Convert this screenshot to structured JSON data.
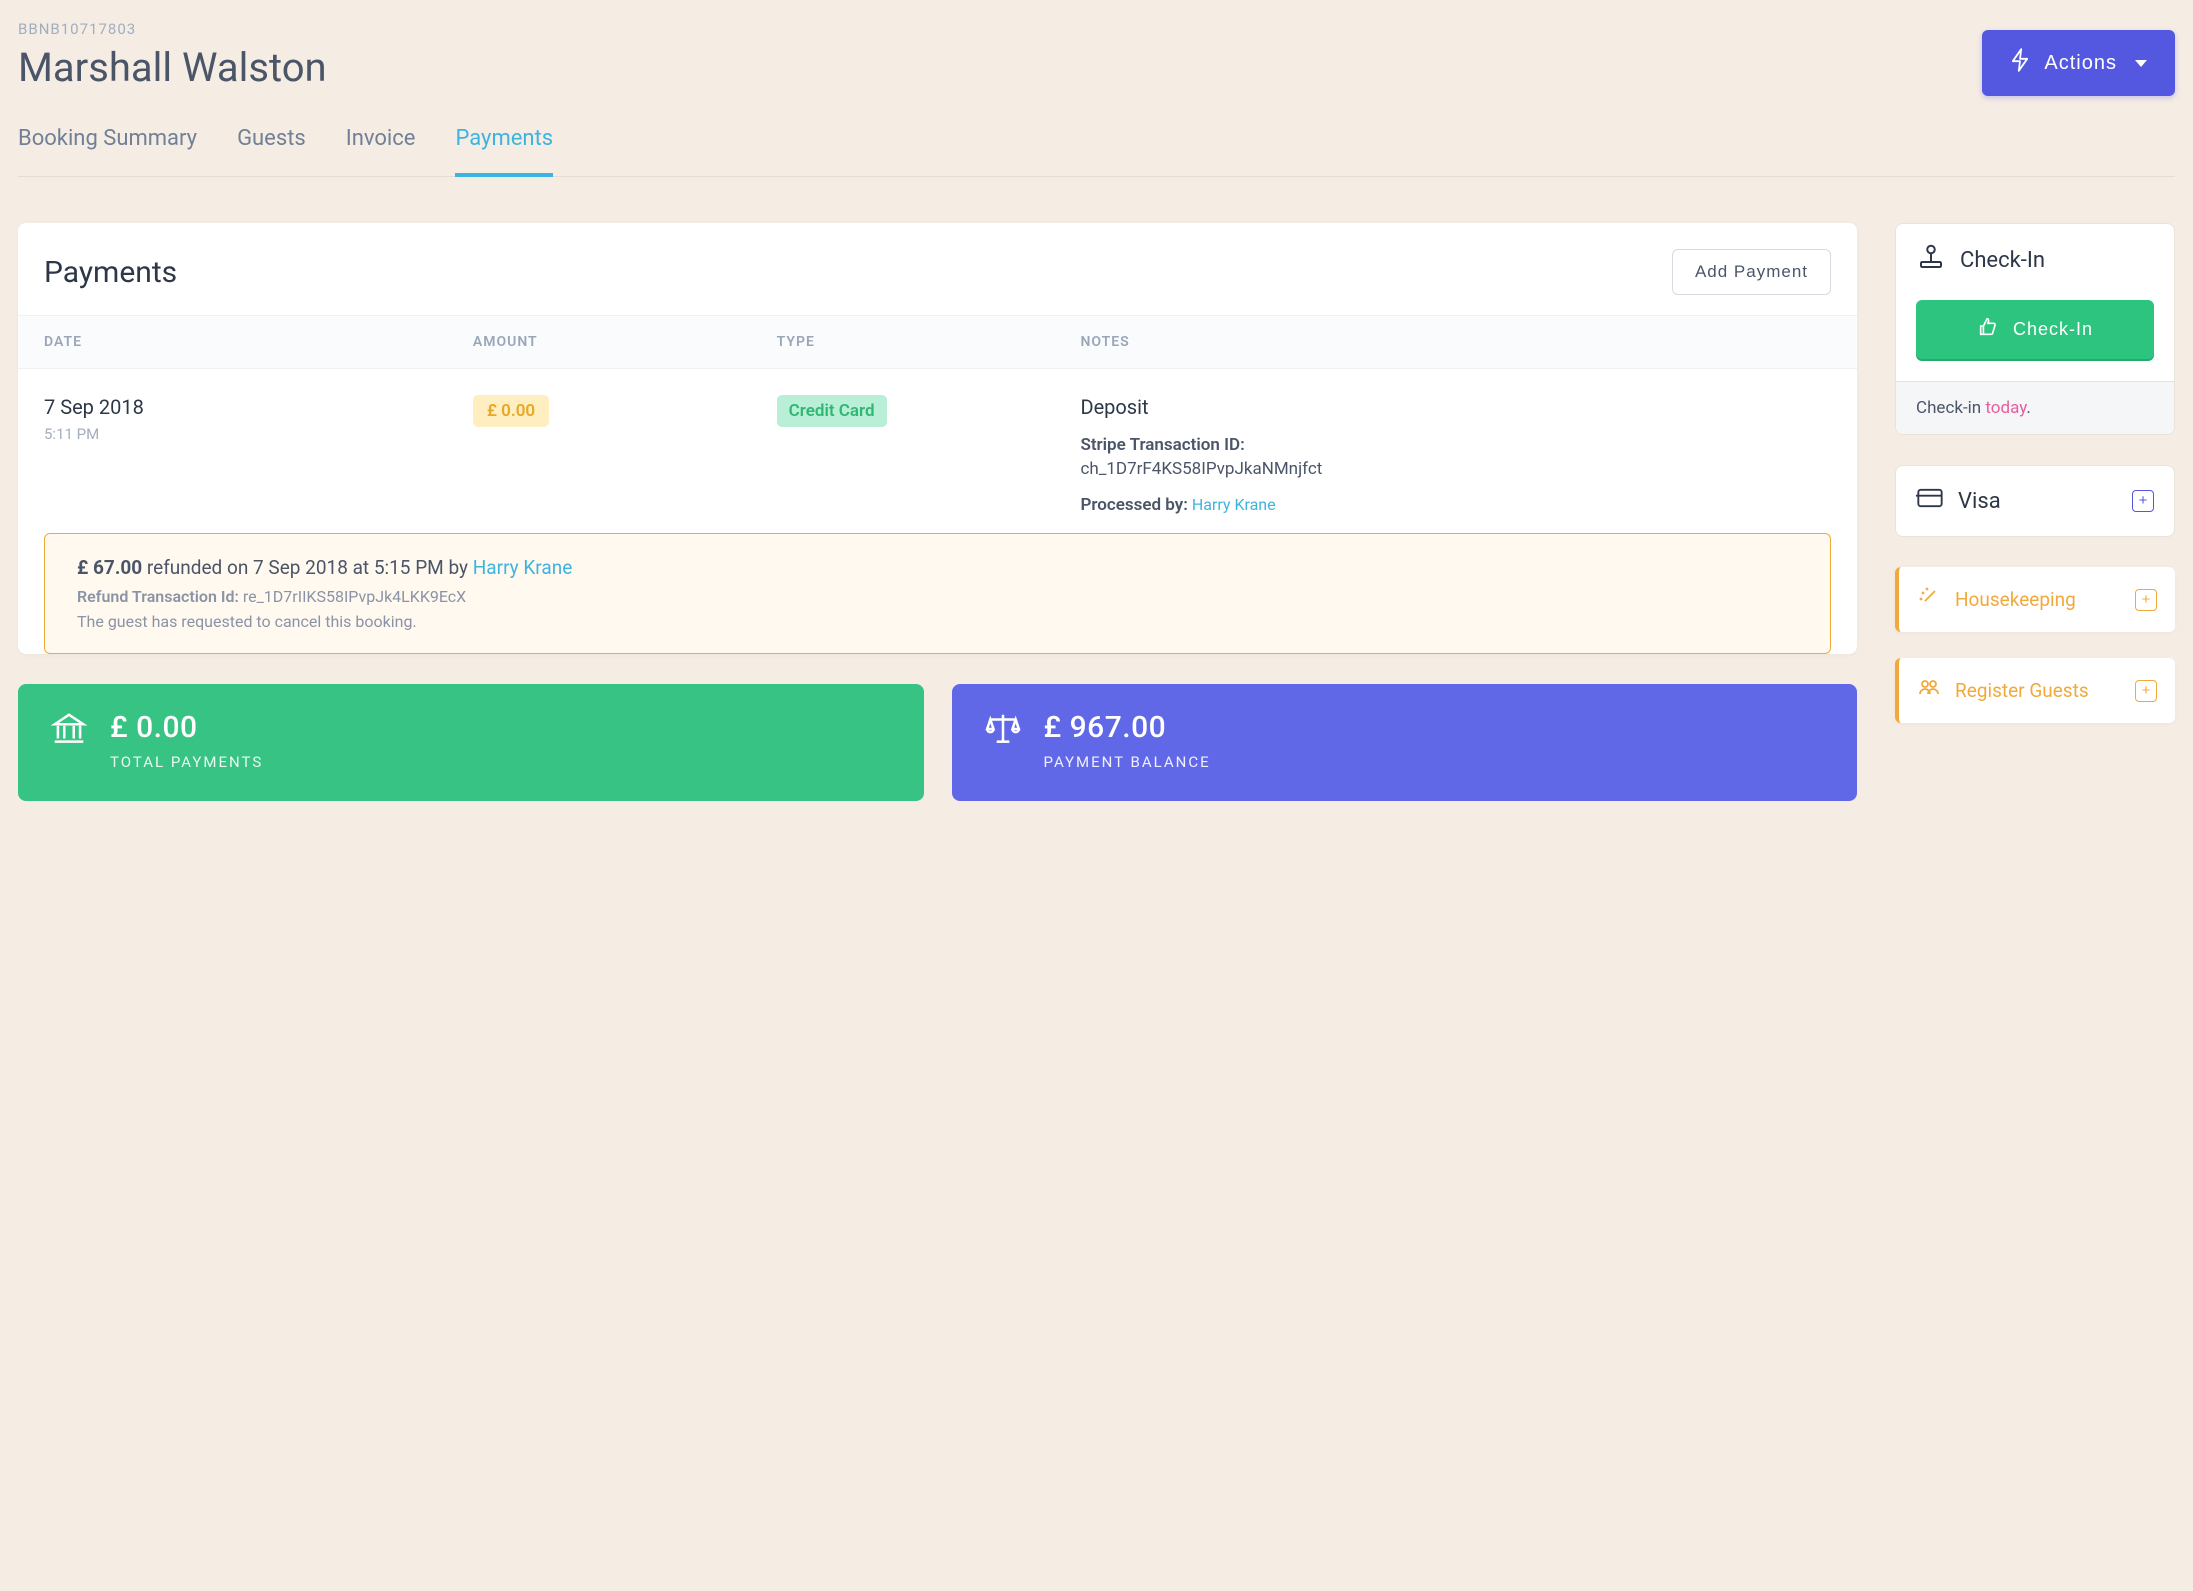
{
  "booking_id": "BBNB10717803",
  "guest_name": "Marshall Walston",
  "actions_label": "Actions",
  "tabs": {
    "summary": "Booking Summary",
    "guests": "Guests",
    "invoice": "Invoice",
    "payments": "Payments"
  },
  "payments": {
    "title": "Payments",
    "add_label": "Add Payment",
    "columns": {
      "date": "DATE",
      "amount": "AMOUNT",
      "type": "TYPE",
      "notes": "NOTES"
    },
    "row": {
      "date": "7 Sep 2018",
      "time": "5:11 PM",
      "amount": "£ 0.00",
      "type": "Credit Card",
      "note_title": "Deposit",
      "stripe_label": "Stripe Transaction ID:",
      "stripe_id": "ch_1D7rF4KS58IPvpJkaNMnjfct",
      "processed_label": "Processed by:",
      "processed_by": "Harry Krane"
    },
    "refund": {
      "amount": "£ 67.00",
      "text1": " refunded on 7 Sep 2018 at 5:15 PM by ",
      "by": "Harry Krane",
      "id_label": "Refund Transaction Id:",
      "id": "re_1D7rIIKS58IPvpJk4LKK9EcX",
      "reason": "The guest has requested to cancel this booking."
    }
  },
  "stats": {
    "total_payments_amount": "£ 0.00",
    "total_payments_label": "TOTAL PAYMENTS",
    "balance_amount": "£ 967.00",
    "balance_label": "PAYMENT BALANCE"
  },
  "sidebar": {
    "checkin_title": "Check-In",
    "checkin_button": "Check-In",
    "checkin_msg_prefix": "Check-in ",
    "checkin_msg_highlight": "today",
    "checkin_msg_suffix": ".",
    "visa_label": "Visa",
    "housekeeping": "Housekeeping",
    "register_guests": "Register Guests"
  }
}
